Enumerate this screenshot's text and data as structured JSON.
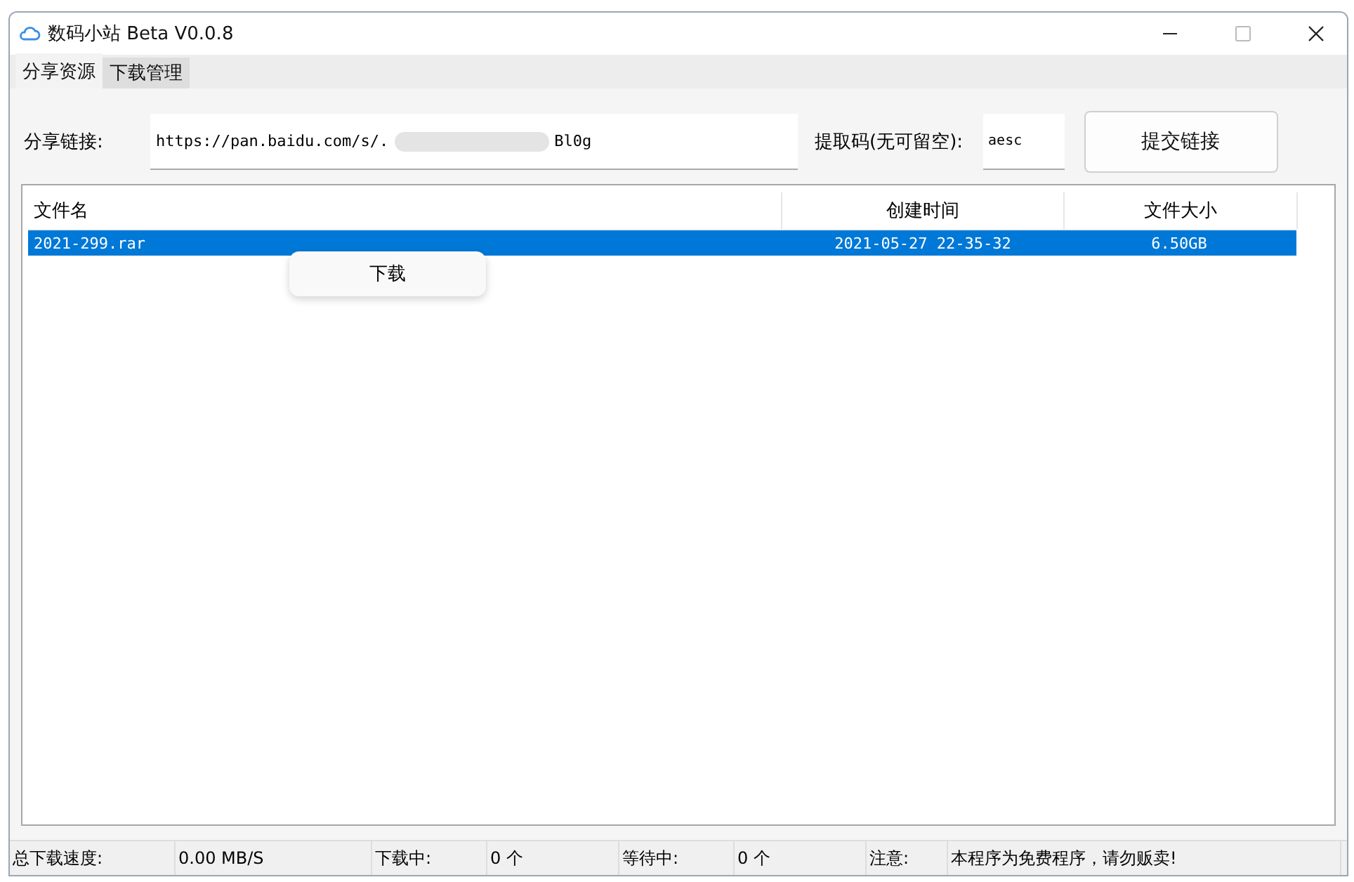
{
  "window": {
    "title": "数码小站 Beta V0.0.8"
  },
  "tabs": [
    {
      "label": "分享资源",
      "selected": true
    },
    {
      "label": "下载管理",
      "selected": false
    }
  ],
  "link_row": {
    "link_label": "分享链接:",
    "link_value_start": "https://pan.baidu.com/s/.",
    "link_value_end": "Bl0g",
    "code_label": "提取码(无可留空):",
    "code_value": "aesc",
    "submit_button": "提交链接"
  },
  "table": {
    "columns": [
      "文件名",
      "创建时间",
      "文件大小"
    ],
    "rows": [
      {
        "cells": [
          "2021-299.rar",
          "2021-05-27 22-35-32",
          "6.50GB"
        ],
        "selected": true
      }
    ]
  },
  "context_menu": {
    "items": [
      "下载"
    ]
  },
  "status_bar": [
    "总下载速度:",
    "0.00 MB/S",
    "下载中:",
    "0 个",
    "等待中:",
    "0 个",
    "注意:",
    "本程序为免费程序，请勿贩卖!"
  ]
}
